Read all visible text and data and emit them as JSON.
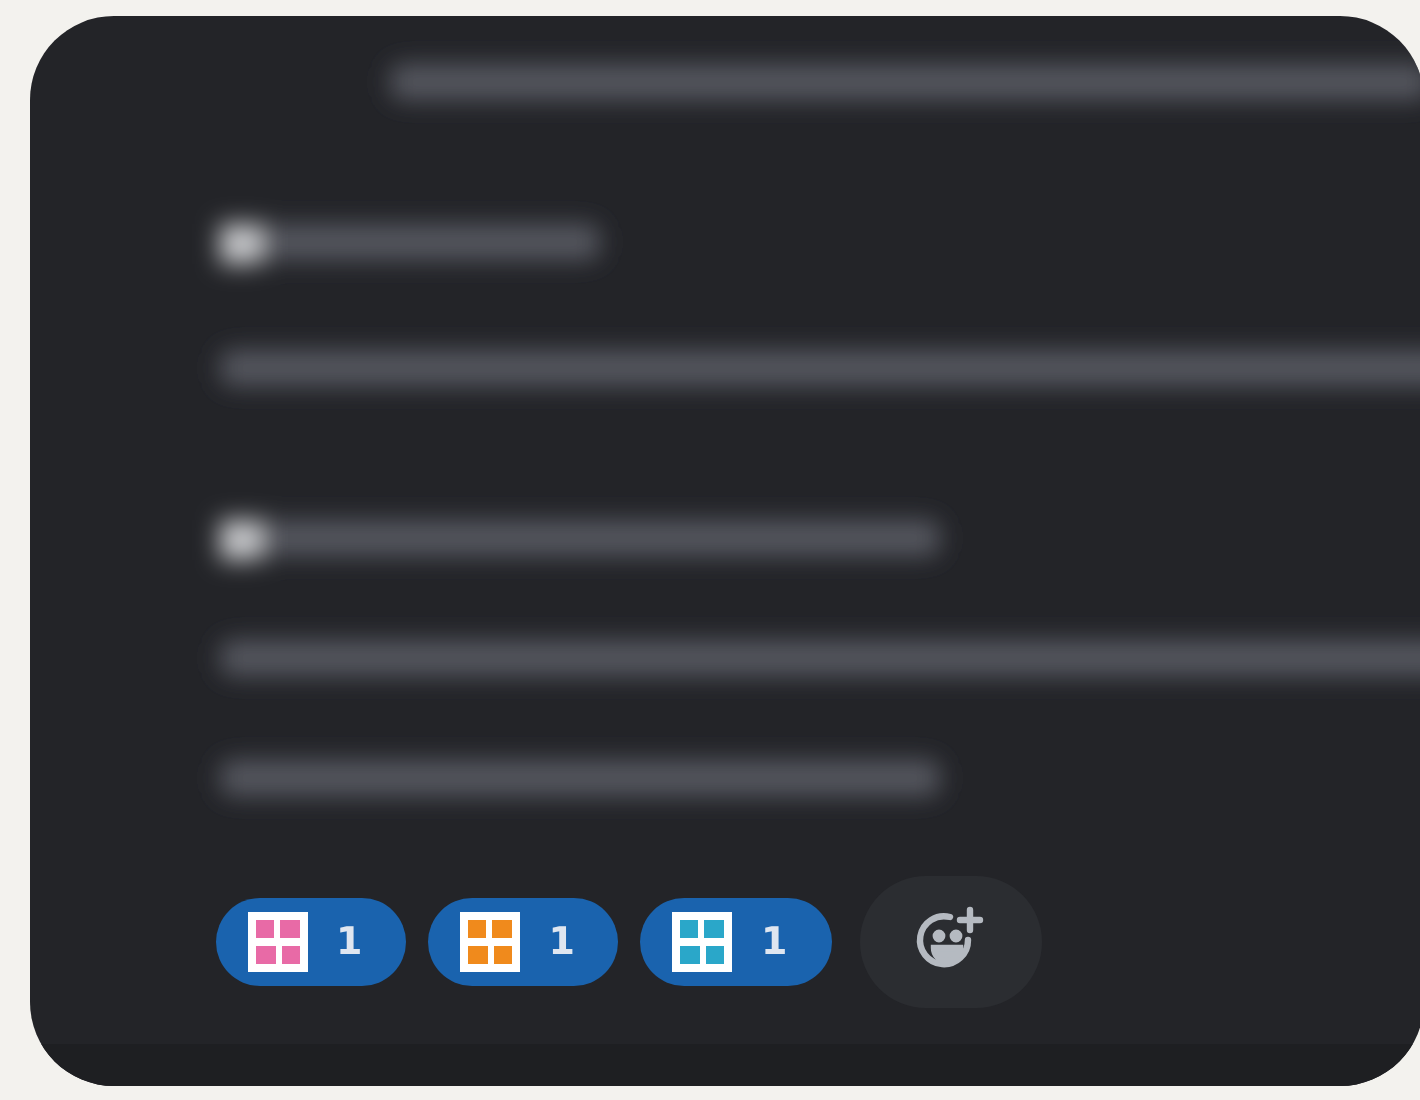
{
  "message": {
    "reactions": [
      {
        "color": "#e86aa6",
        "count": "1",
        "selected": true
      },
      {
        "color": "#f08a1c",
        "count": "1",
        "selected": true
      },
      {
        "color": "#2aa7c9",
        "count": "1",
        "selected": true
      }
    ]
  }
}
